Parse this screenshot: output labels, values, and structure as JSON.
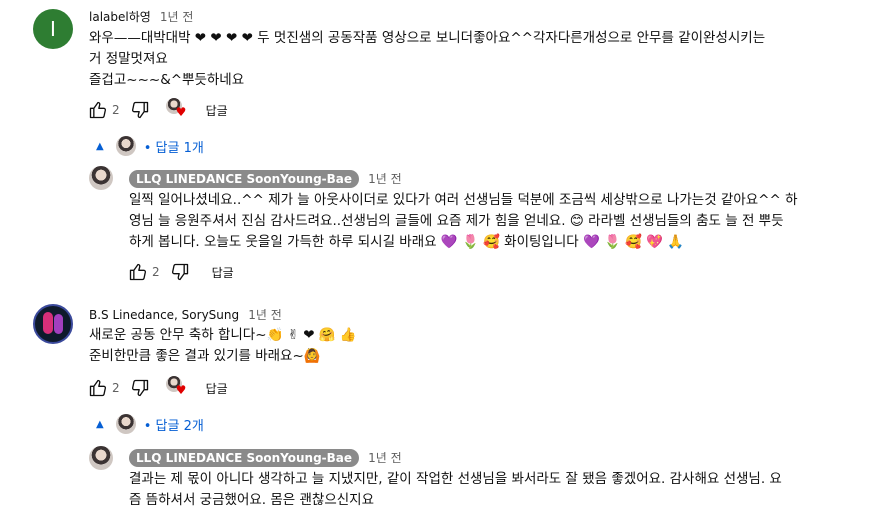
{
  "comments": [
    {
      "author": "lalabel하영",
      "avatar_letter": "I",
      "time": "1년 전",
      "lines": [
        "와우——대박대박 ❤ ❤ ❤ ❤ 두 멋진샘의 공동작품 영상으로 보니더좋아요^^각자다른개성으로 안무를 같이완성시키는",
        "거 정말멋져요",
        "즐겁고~~~&^뿌듯하네요"
      ],
      "likes": "2",
      "reply_label": "답글",
      "replies_toggle": "답글 1개",
      "replies": [
        {
          "author": "LLQ LINEDANCE SoonYoung-Bae",
          "time": "1년 전",
          "lines": [
            "일찍 일어나셨네요..^^ 제가 늘 아웃사이더로 있다가 여러 선생님들 덕분에 조금씩 세상밖으로 나가는것 같아요^^ 하",
            "영님 늘 응원주셔서 진심 감사드려요..선생님의 글들에 요즘 제가 힘을 얻네요. 😊 라라벨 선생님들의 춤도 늘 전 뿌듯",
            "하게 봅니다. 오늘도 웃을일 가득한 하루 되시길 바래요 💜 🌷 🥰  화이팅입니다 💜 🌷 🥰 💖 🙏"
          ],
          "likes": "2",
          "reply_label": "답글"
        }
      ]
    },
    {
      "author": "B.S Linedance, SorySung",
      "time": "1년 전",
      "lines": [
        "새로운 공동 안무 축하 합니다~👏 ✌ ❤ 🤗 👍",
        "준비한만큼 좋은 결과 있기를 바래요~🙆"
      ],
      "likes": "2",
      "reply_label": "답글",
      "replies_toggle": "답글 2개",
      "replies": [
        {
          "author": "LLQ LINEDANCE SoonYoung-Bae",
          "time": "1년 전",
          "lines": [
            "결과는 제 몫이 아니다 생각하고 늘 지냈지만,  같이 작업한 선생님을 봐서라도 잘 됐음 좋겠어요. 감사해요 선생님. 요",
            "즘 뜸하셔서 궁금했어요. 몸은 괜찮으신지요"
          ]
        }
      ]
    }
  ],
  "colors": {
    "link": "#065fd4",
    "chip": "#8a8a8a",
    "heart": "#e00000",
    "meta": "#606060"
  }
}
